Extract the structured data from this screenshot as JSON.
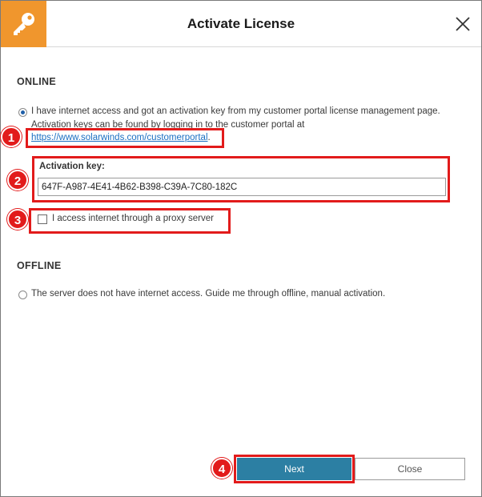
{
  "dialog": {
    "title": "Activate License",
    "colors": {
      "accent": "#f0962d",
      "primary_button": "#2c7fa3",
      "highlight": "#e21b1b",
      "link": "#1a6fc2"
    }
  },
  "online": {
    "heading": "ONLINE",
    "radio_selected": true,
    "option_line1": "I have internet access and got an activation key from my customer portal license management page.",
    "option_line2": "Activation keys can be found by logging in to the customer portal at",
    "portal_link": "https://www.solarwinds.com/customerportal",
    "link_suffix": ".",
    "activation_key_label": "Activation key:",
    "activation_key_value": "647F-A987-4E41-4B62-B398-C39A-7C80-182C",
    "proxy_checked": false,
    "proxy_label": "I access internet through a proxy server"
  },
  "offline": {
    "heading": "OFFLINE",
    "radio_selected": false,
    "option_label": "The server does not have internet access. Guide me through offline, manual activation."
  },
  "buttons": {
    "next": "Next",
    "close": "Close"
  },
  "callouts": [
    "1",
    "2",
    "3",
    "4"
  ]
}
